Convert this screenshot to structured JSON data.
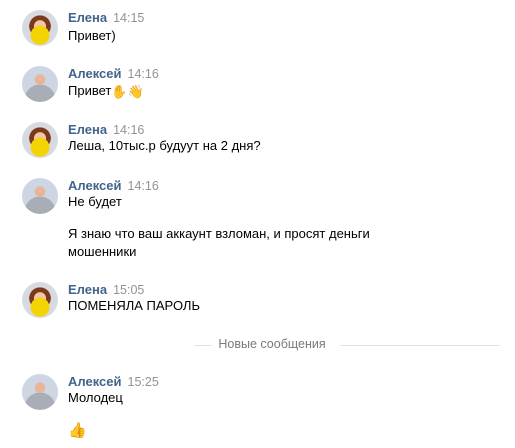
{
  "messages": [
    {
      "author": "Елена",
      "time": "14:15",
      "lines": [
        "Привет)"
      ]
    },
    {
      "author": "Алексей",
      "time": "14:16",
      "lines": [
        "Привет"
      ],
      "emojis": [
        "✋",
        "👋"
      ]
    },
    {
      "author": "Елена",
      "time": "14:16",
      "lines": [
        "Леша, 10тыс.р будуут на 2 дня?"
      ]
    },
    {
      "author": "Алексей",
      "time": "14:16",
      "lines": [
        "Не будет",
        "Я знаю что ваш аккаунт взломан, и просят деньги",
        "мошенники"
      ]
    },
    {
      "author": "Елена",
      "time": "15:05",
      "lines": [
        "ПОМЕНЯЛА ПАРОЛЬ"
      ]
    },
    {
      "author": "Алексей",
      "time": "15:25",
      "lines": [
        "Молодец"
      ],
      "emojis": [
        "👍"
      ]
    }
  ],
  "divider": {
    "label": "Новые сообщения"
  },
  "colors": {
    "author_name": "#42648b",
    "timestamp": "#939393",
    "divider_line": "#dde3ea"
  }
}
